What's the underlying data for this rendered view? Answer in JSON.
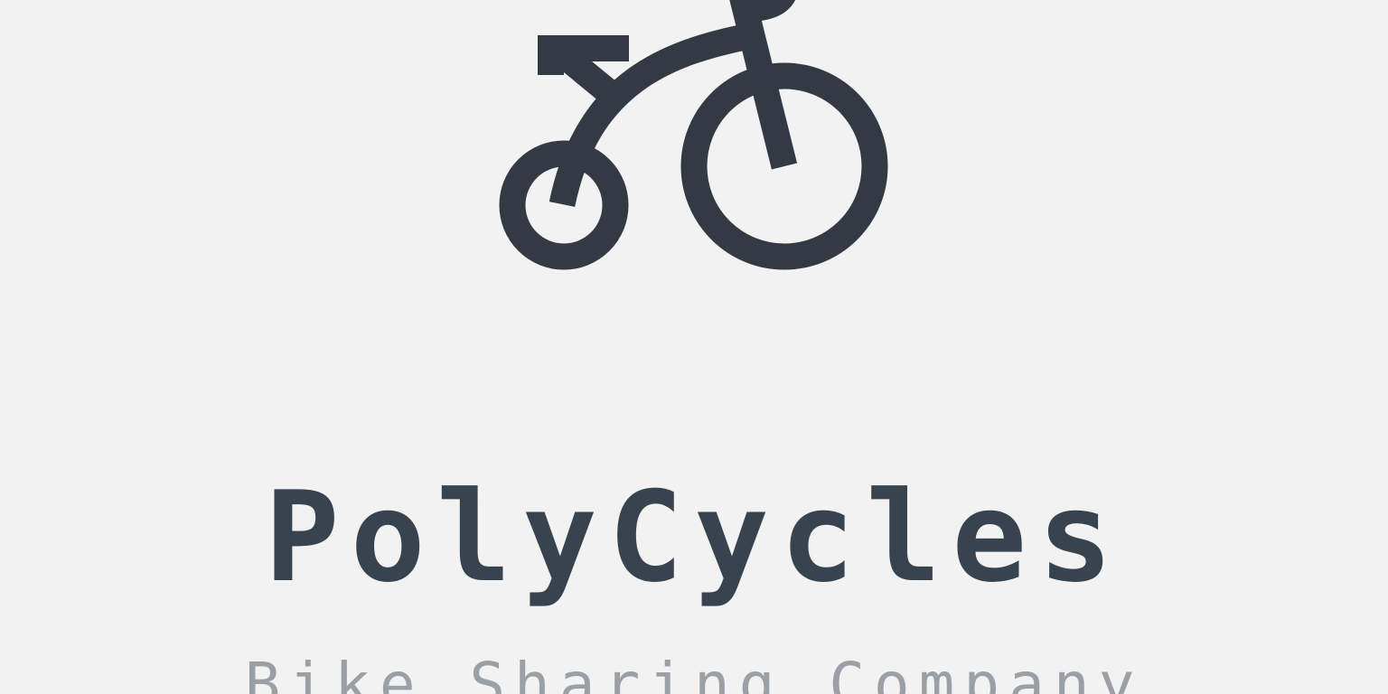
{
  "brand": {
    "name": "PolyCycles",
    "tagline": "Bike Sharing Company",
    "logo_icon": "bicycle-icon"
  },
  "colors": {
    "background": "#f2f2f2",
    "logo": "#333a43",
    "title": "#37434f",
    "tagline": "#9aa0a5"
  }
}
